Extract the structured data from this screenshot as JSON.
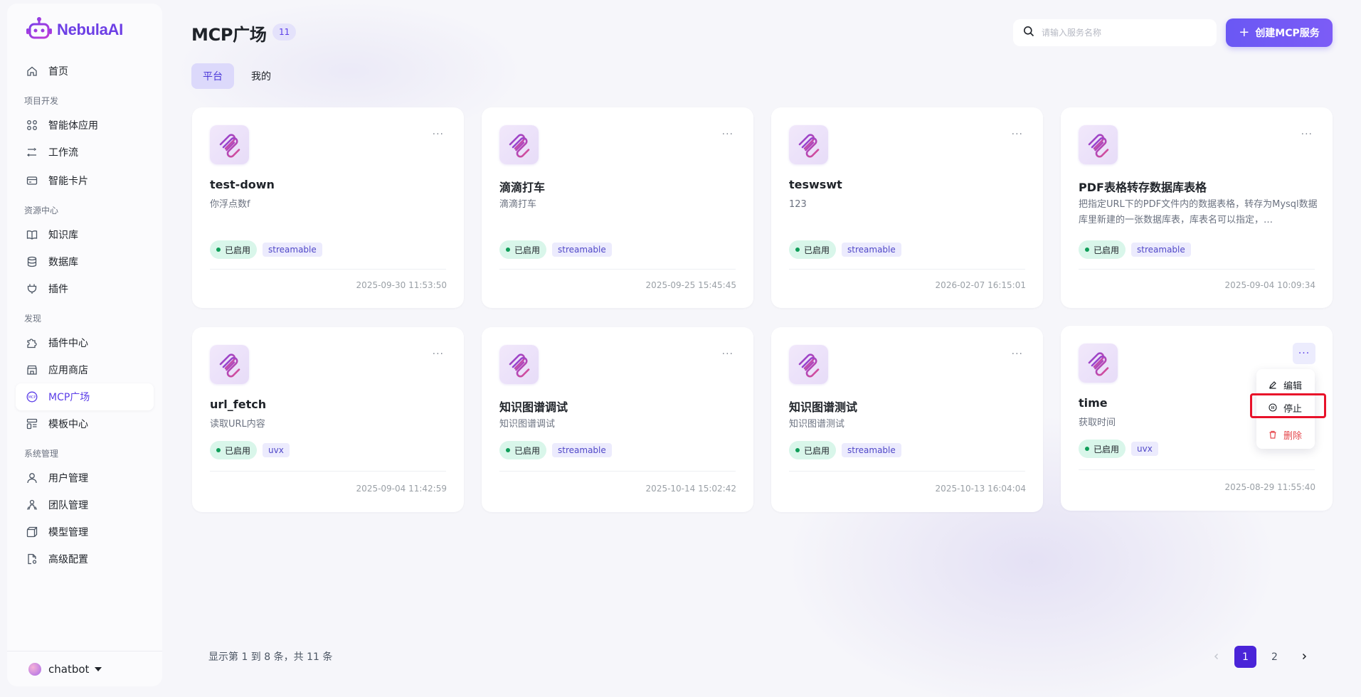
{
  "app": {
    "name": "NebulaAI"
  },
  "sidebar": {
    "items": [
      {
        "label": "首页",
        "icon": "home-icon"
      },
      {
        "section": "项目开发"
      },
      {
        "label": "智能体应用",
        "icon": "grid-icon"
      },
      {
        "label": "工作流",
        "icon": "workflow-icon"
      },
      {
        "label": "智能卡片",
        "icon": "card-icon"
      },
      {
        "section": "资源中心"
      },
      {
        "label": "知识库",
        "icon": "book-icon"
      },
      {
        "label": "数据库",
        "icon": "database-icon"
      },
      {
        "label": "插件",
        "icon": "plug-icon"
      },
      {
        "section": "发现"
      },
      {
        "label": "插件中心",
        "icon": "puzzle-icon"
      },
      {
        "label": "应用商店",
        "icon": "store-icon"
      },
      {
        "label": "MCP广场",
        "icon": "mcp-icon",
        "active": true
      },
      {
        "label": "模板中心",
        "icon": "template-icon"
      },
      {
        "section": "系统管理"
      },
      {
        "label": "用户管理",
        "icon": "user-icon"
      },
      {
        "label": "团队管理",
        "icon": "team-icon"
      },
      {
        "label": "模型管理",
        "icon": "cube-icon"
      },
      {
        "label": "高级配置",
        "icon": "settings-file-icon"
      }
    ],
    "user": {
      "name": "chatbot"
    }
  },
  "header": {
    "title": "MCP广场",
    "count": "11",
    "search_placeholder": "请输入服务名称",
    "create_label": "创建MCP服务"
  },
  "tabs": [
    {
      "label": "平台",
      "active": true
    },
    {
      "label": "我的",
      "active": false
    }
  ],
  "cards": [
    {
      "title": "test-down",
      "desc": "你浮点数f",
      "status": "已启用",
      "type": "streamable",
      "time": "2025-09-30 11:53:50"
    },
    {
      "title": "滴滴打车",
      "desc": "滴滴打车",
      "status": "已启用",
      "type": "streamable",
      "time": "2025-09-25 15:45:45"
    },
    {
      "title": "teswswt",
      "desc": "123",
      "status": "已启用",
      "type": "streamable",
      "time": "2026-02-07 16:15:01"
    },
    {
      "title": "PDF表格转存数据库表格",
      "desc": "把指定URL下的PDF文件内的数据表格，转存为Mysql数据库里新建的一张数据库表，库表名可以指定，…",
      "status": "已启用",
      "type": "streamable",
      "time": "2025-09-04 10:09:34"
    },
    {
      "title": "url_fetch",
      "desc": "读取URL内容",
      "status": "已启用",
      "type": "uvx",
      "time": "2025-09-04 11:42:59"
    },
    {
      "title": "知识图谱调试",
      "desc": "知识图谱调试",
      "status": "已启用",
      "type": "streamable",
      "time": "2025-10-14 15:02:42"
    },
    {
      "title": "知识图谱测试",
      "desc": "知识图谱测试",
      "status": "已启用",
      "type": "streamable",
      "time": "2025-10-13 16:04:04"
    },
    {
      "title": "time",
      "desc": "获取时间",
      "status": "已启用",
      "type": "uvx",
      "time": "2025-08-29 11:55:40"
    }
  ],
  "card_menu": {
    "edit": "编辑",
    "stop": "停止",
    "delete": "删除"
  },
  "pagination": {
    "info": "显示第 1 到 8 条，共 11 条",
    "pages": [
      "1",
      "2"
    ],
    "current": "1"
  },
  "colors": {
    "accent": "#5b3ee8",
    "status_bg": "#d9f6ea",
    "status_dot": "#0f9d58",
    "danger": "#e5484d",
    "highlight": "#e8122a"
  }
}
